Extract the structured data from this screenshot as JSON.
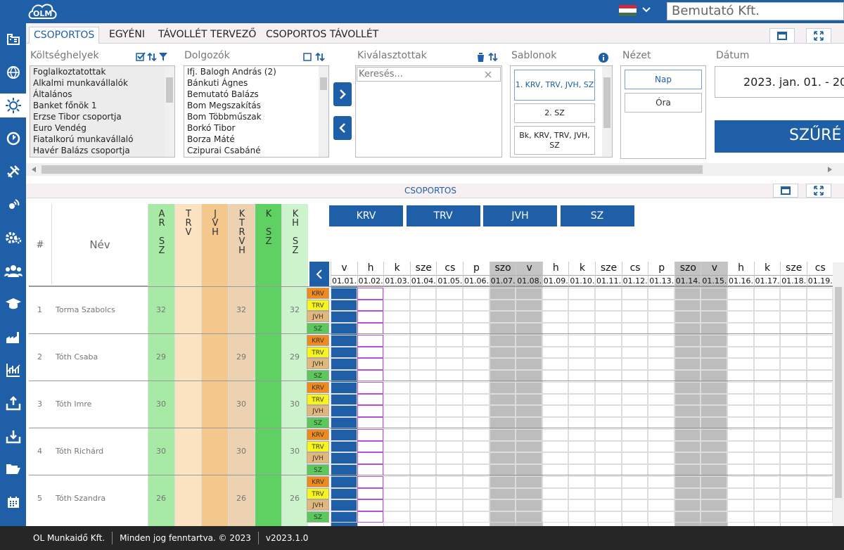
{
  "app": {
    "logo_text": "OLM",
    "company": "Bemutató Kft."
  },
  "tabs": [
    {
      "label": "CSOPORTOS"
    },
    {
      "label": "EGYÉNI"
    },
    {
      "label": "TÁVOLLÉT TERVEZŐ"
    },
    {
      "label": "CSOPORTOS TÁVOLLÉT"
    }
  ],
  "filters": {
    "costcenters": {
      "label": "Költséghelyek",
      "items": [
        "Foglalkoztatottak",
        "Alkalmi munkavállalók",
        "Általános",
        "Banket főnök 1",
        "Erzse Tibor csoportja",
        "Euro Vendég",
        "Fiatalkorú munkavállaló",
        "Havér Balázs csoportja"
      ]
    },
    "employees": {
      "label": "Dolgozók",
      "items": [
        "Ifj. Balogh András (2)",
        "Bánkuti Ágnes",
        "Bemutató Balázs",
        "Bom Megszakítás",
        "Bom Többműszak",
        "Borkó Tibor",
        "Borza Máté",
        "Czipurai Csabáné"
      ]
    },
    "selected": {
      "label": "Kiválasztottak",
      "search_placeholder": "Keresés..."
    },
    "templates": {
      "label": "Sablonok",
      "items": [
        "1. KRV, TRV, JVH, SZ",
        "2. SZ",
        "Bk, KRV, TRV, JVH, SZ"
      ]
    },
    "view": {
      "label": "Nézet",
      "options": [
        "Nap",
        "Óra"
      ]
    },
    "date": {
      "label": "Dátum",
      "value": "2023. jan. 01. - 20"
    },
    "filter_button": "SZŰRÉ"
  },
  "section": {
    "title": "CSOPORTOS"
  },
  "table": {
    "col_num": "#",
    "col_name": "Név",
    "stat_cols": [
      {
        "letters": [
          "A",
          "R",
          "",
          "S",
          "Z"
        ],
        "bg": "#a6eaa6"
      },
      {
        "letters": [
          "T",
          "R",
          "V"
        ],
        "bg": "#fbe2c0"
      },
      {
        "letters": [
          "J",
          "V",
          "H"
        ],
        "bg": "#f4c88d"
      },
      {
        "letters": [
          "K",
          "T",
          "R",
          "V",
          "H"
        ],
        "bg": "#ecd2b0"
      },
      {
        "letters": [
          "K",
          "",
          "S",
          "Z"
        ],
        "bg": "#5ed162"
      },
      {
        "letters": [
          "K",
          "H",
          "",
          "S",
          "Z"
        ],
        "bg": "#cdf3cd"
      }
    ],
    "legend_buttons": [
      "KRV",
      "TRV",
      "JVH",
      "SZ"
    ],
    "chips": [
      {
        "label": "KRV",
        "color": "#f08a1c"
      },
      {
        "label": "TRV",
        "color": "#f7f51a"
      },
      {
        "label": "JVH",
        "color": "#e2b77c"
      },
      {
        "label": "SZ",
        "color": "#5ac85a"
      }
    ],
    "days": [
      {
        "n": "v",
        "d": "01.01."
      },
      {
        "n": "h",
        "d": "01.02."
      },
      {
        "n": "k",
        "d": "01.03."
      },
      {
        "n": "sze",
        "d": "01.04."
      },
      {
        "n": "cs",
        "d": "01.05."
      },
      {
        "n": "p",
        "d": "01.06."
      },
      {
        "n": "szo",
        "d": "01.07."
      },
      {
        "n": "v",
        "d": "01.08."
      },
      {
        "n": "h",
        "d": "01.09."
      },
      {
        "n": "k",
        "d": "01.10."
      },
      {
        "n": "sze",
        "d": "01.11."
      },
      {
        "n": "cs",
        "d": "01.12."
      },
      {
        "n": "p",
        "d": "01.13."
      },
      {
        "n": "szo",
        "d": "01.14."
      },
      {
        "n": "v",
        "d": "01.15."
      },
      {
        "n": "h",
        "d": "01.16."
      },
      {
        "n": "k",
        "d": "01.17."
      },
      {
        "n": "sze",
        "d": "01.18."
      },
      {
        "n": "cs",
        "d": "01.19."
      }
    ],
    "rows": [
      {
        "num": "1",
        "name": "Torma Szabolcs",
        "ar_sz": "32",
        "ktrvh": "32",
        "kh_sz": "32"
      },
      {
        "num": "2",
        "name": "Tóth Csaba",
        "ar_sz": "29",
        "ktrvh": "29",
        "kh_sz": "29"
      },
      {
        "num": "3",
        "name": "Tóth Imre",
        "ar_sz": "30",
        "ktrvh": "30",
        "kh_sz": "30"
      },
      {
        "num": "4",
        "name": "Tóth Richárd",
        "ar_sz": "30",
        "ktrvh": "30",
        "kh_sz": "30"
      },
      {
        "num": "5",
        "name": "Tóth Szandra",
        "ar_sz": "26",
        "ktrvh": "26",
        "kh_sz": "26"
      }
    ]
  },
  "footer": {
    "company": "OL Munkaidő Kft.",
    "rights": "Minden jog fenntartva. © 2023",
    "version": "v2023.1.0"
  }
}
